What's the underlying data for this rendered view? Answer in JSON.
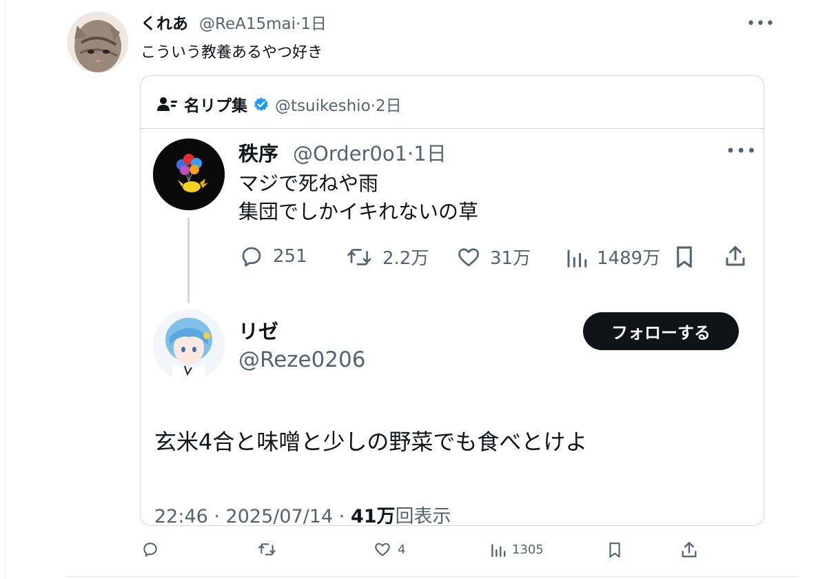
{
  "outer_tweet": {
    "name": "くれあ",
    "handle_time": "@ReA15mai·1日",
    "text": "こういう教養あるやつ好き",
    "more": "•••",
    "actions": {
      "reply_count": "",
      "retweet_count": "",
      "like_count": "4",
      "view_count": "1305"
    }
  },
  "quote": {
    "header": {
      "name": "名リプ集",
      "handle_time": "@tsuikeshio·2日",
      "verified": true
    },
    "original": {
      "name": "秩序",
      "handle_time": "@Order0o1·1日",
      "text_lines": [
        "マジで死ねや雨",
        "集団でしかイキれないの草"
      ],
      "more": "•••",
      "actions": {
        "reply_count": "251",
        "retweet_count": "2.2万",
        "like_count": "31万",
        "view_count": "1489万"
      }
    },
    "reply": {
      "name": "リゼ",
      "handle": "@Reze0206",
      "follow_label": "フォローする",
      "text": "玄米4合と味噌と少しの野菜でも食べとけよ",
      "meta_prefix": "22:46 · 2025/07/14 · ",
      "meta_views": "41万",
      "meta_suffix": "回表示"
    }
  },
  "colors": {
    "text_primary": "#0f1419",
    "text_secondary": "#536471",
    "border": "#cfd9de",
    "verified_blue": "#1d9bf0",
    "button_bg": "#0f1419"
  }
}
